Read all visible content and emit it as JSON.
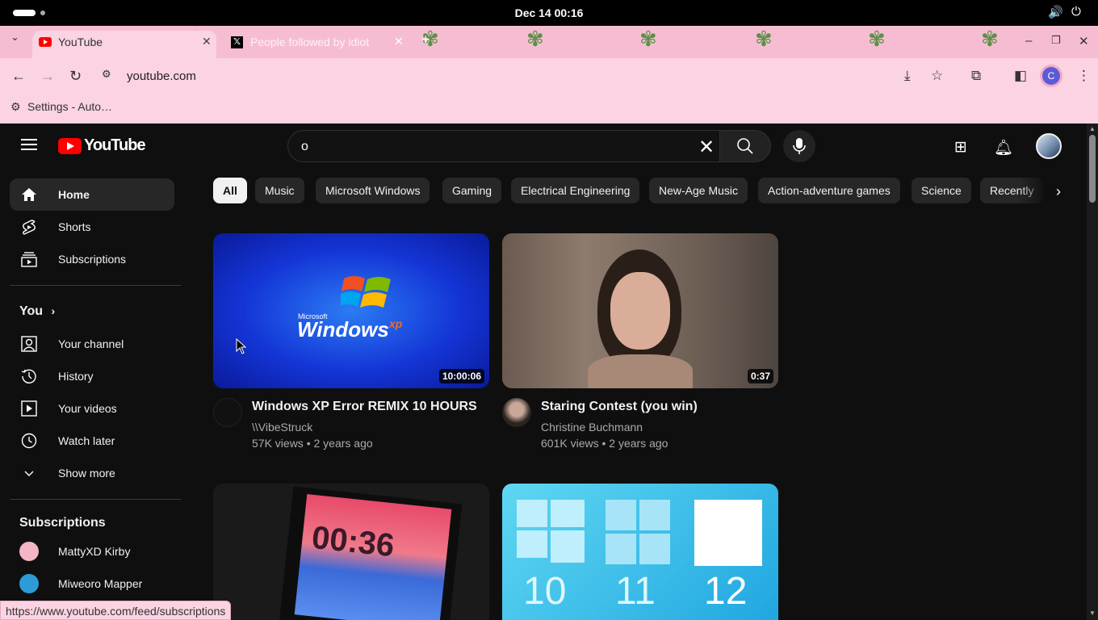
{
  "system": {
    "clock": "Dec 14  00:16"
  },
  "browser": {
    "tabs": [
      {
        "title": "YouTube",
        "active": true
      },
      {
        "title": "People followed by idiot",
        "active": false
      }
    ],
    "url": "youtube.com",
    "profile_initial": "C",
    "bookmarks": [
      {
        "label": "Settings - Auto…"
      }
    ],
    "status_url": "https://www.youtube.com/feed/subscriptions"
  },
  "header": {
    "logo_text": "YouTube",
    "search_value": "o"
  },
  "sidebar": {
    "main": [
      {
        "label": "Home",
        "icon": "home-icon",
        "active": true
      },
      {
        "label": "Shorts",
        "icon": "shorts-icon"
      },
      {
        "label": "Subscriptions",
        "icon": "subscriptions-icon"
      }
    ],
    "you_title": "You",
    "you_items": [
      {
        "label": "Your channel",
        "icon": "your-channel-icon"
      },
      {
        "label": "History",
        "icon": "history-icon"
      },
      {
        "label": "Your videos",
        "icon": "your-videos-icon"
      },
      {
        "label": "Watch later",
        "icon": "watch-later-icon"
      },
      {
        "label": "Show more",
        "icon": "chevron-down-icon"
      }
    ],
    "subs_title": "Subscriptions",
    "subs": [
      {
        "label": "MattyXD Kirby",
        "color": "#f4b5c7"
      },
      {
        "label": "Miweoro Mapper",
        "color": "#2d9bd8"
      }
    ]
  },
  "chips": [
    "All",
    "Music",
    "Microsoft Windows",
    "Gaming",
    "Electrical Engineering",
    "New-Age Music",
    "Action-adventure games",
    "Science",
    "Recently"
  ],
  "videos": [
    {
      "title": "Windows XP Error REMIX 10 HOURS",
      "channel": "\\\\VibeStruck",
      "meta": "57K views • 2 years ago",
      "duration": "10:00:06",
      "thumb_text_small": "Microsoft",
      "thumb_text": "Windows",
      "thumb_text_sup": "xp"
    },
    {
      "title": "Staring Contest (you win)",
      "channel": "Christine Buchmann",
      "meta": "601K views • 2 years ago",
      "duration": "0:37"
    },
    {
      "thumb_clock": "00:36"
    },
    {
      "labels": [
        "10",
        "11",
        "12"
      ]
    }
  ]
}
